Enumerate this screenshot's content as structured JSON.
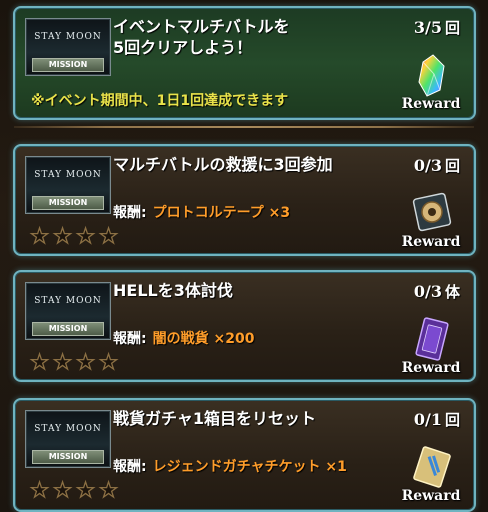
{
  "missions": [
    {
      "banner_title": "STAY MOON",
      "banner_tag": "MISSION",
      "title": "イベントマルチバトルを\n5回クリアしよう！",
      "progress": "3/5",
      "unit": "回",
      "note": "※イベント期間中、1日1回達成できます",
      "reward_label": "Reward",
      "reward_icon": "rainbow-crystal-icon"
    },
    {
      "banner_title": "STAY MOON",
      "banner_tag": "MISSION",
      "title": "マルチバトルの救援に3回参加",
      "progress": "0/3",
      "unit": "回",
      "reward_prefix": "報酬:",
      "reward_item": "プロトコルテープ ×3",
      "reward_label": "Reward",
      "reward_icon": "tape-icon"
    },
    {
      "banner_title": "STAY MOON",
      "banner_tag": "MISSION",
      "title": "HELLを3体討伐",
      "progress": "0/3",
      "unit": "体",
      "reward_prefix": "報酬:",
      "reward_item": "闇の戦貨 ×200",
      "reward_label": "Reward",
      "reward_icon": "dark-medal-icon"
    },
    {
      "banner_title": "STAY MOON",
      "banner_tag": "MISSION",
      "title": "戦貨ガチャ1箱目をリセット",
      "progress": "0/1",
      "unit": "回",
      "reward_prefix": "報酬:",
      "reward_item": "レジェンドガチャチケット ×1",
      "reward_label": "Reward",
      "reward_icon": "gacha-ticket-icon"
    }
  ]
}
